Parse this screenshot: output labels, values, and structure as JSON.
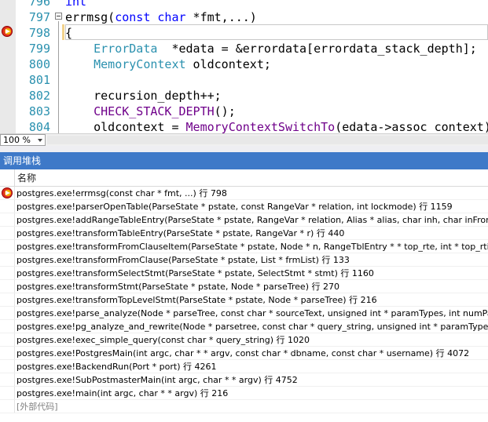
{
  "editor": {
    "lines": [
      {
        "num": "796",
        "parts": [
          {
            "t": "int",
            "c": "kw"
          }
        ]
      },
      {
        "num": "797",
        "parts": [
          {
            "t": "errmsg(",
            "c": ""
          },
          {
            "t": "const",
            "c": "kw"
          },
          {
            "t": " ",
            "c": ""
          },
          {
            "t": "char",
            "c": "kw"
          },
          {
            "t": " *fmt,...)",
            "c": ""
          }
        ]
      },
      {
        "num": "798",
        "parts": [
          {
            "t": "{",
            "c": ""
          }
        ]
      },
      {
        "num": "799",
        "parts": [
          {
            "t": "    ",
            "c": ""
          },
          {
            "t": "ErrorData",
            "c": "typ"
          },
          {
            "t": "  *edata = &errordata[errordata_stack_depth];",
            "c": ""
          }
        ]
      },
      {
        "num": "800",
        "parts": [
          {
            "t": "    ",
            "c": ""
          },
          {
            "t": "MemoryContext",
            "c": "typ"
          },
          {
            "t": " oldcontext;",
            "c": ""
          }
        ]
      },
      {
        "num": "801",
        "parts": []
      },
      {
        "num": "802",
        "parts": [
          {
            "t": "    recursion_depth++;",
            "c": ""
          }
        ]
      },
      {
        "num": "803",
        "parts": [
          {
            "t": "    ",
            "c": ""
          },
          {
            "t": "CHECK_STACK_DEPTH",
            "c": "mac"
          },
          {
            "t": "();",
            "c": ""
          }
        ]
      },
      {
        "num": "804",
        "parts": [
          {
            "t": "    oldcontext = ",
            "c": ""
          },
          {
            "t": "MemoryContextSwitchTo",
            "c": "mac"
          },
          {
            "t": "(edata->assoc_context);",
            "c": ""
          }
        ]
      }
    ],
    "current_line": "798"
  },
  "zoom": {
    "value": "100 %"
  },
  "call_stack": {
    "title": "调用堆栈",
    "column_name": "名称",
    "frames": [
      {
        "text": "postgres.exe!errmsg(const char * fmt, ...) 行 798",
        "current": true
      },
      {
        "text": "postgres.exe!parserOpenTable(ParseState * pstate, const RangeVar * relation, int lockmode) 行 1159"
      },
      {
        "text": "postgres.exe!addRangeTableEntry(ParseState * pstate, RangeVar * relation, Alias * alias, char inh, char inFromCl) 行"
      },
      {
        "text": "postgres.exe!transformTableEntry(ParseState * pstate, RangeVar * r) 行 440"
      },
      {
        "text": "postgres.exe!transformFromClauseItem(ParseState * pstate, Node * n, RangeTblEntry * * top_rte, int * top_rti, List *"
      },
      {
        "text": "postgres.exe!transformFromClause(ParseState * pstate, List * frmList) 行 133"
      },
      {
        "text": "postgres.exe!transformSelectStmt(ParseState * pstate, SelectStmt * stmt) 行 1160"
      },
      {
        "text": "postgres.exe!transformStmt(ParseState * pstate, Node * parseTree) 行 270"
      },
      {
        "text": "postgres.exe!transformTopLevelStmt(ParseState * pstate, Node * parseTree) 行 216"
      },
      {
        "text": "postgres.exe!parse_analyze(Node * parseTree, const char * sourceText, unsigned int * paramTypes, int numParams)"
      },
      {
        "text": "postgres.exe!pg_analyze_and_rewrite(Node * parsetree, const char * query_string, unsigned int * paramTypes, int nu"
      },
      {
        "text": "postgres.exe!exec_simple_query(const char * query_string) 行 1020"
      },
      {
        "text": "postgres.exe!PostgresMain(int argc, char * * argv, const char * dbname, const char * username) 行 4072"
      },
      {
        "text": "postgres.exe!BackendRun(Port * port) 行 4261"
      },
      {
        "text": "postgres.exe!SubPostmasterMain(int argc, char * * argv) 行 4752"
      },
      {
        "text": "postgres.exe!main(int argc, char * * argv) 行 216"
      },
      {
        "text": "[外部代码]",
        "external": true
      }
    ]
  },
  "icons": {
    "current_statement": "current-statement-arrow-icon",
    "fold": "collapse-icon"
  },
  "colors": {
    "panel_title_bg": "#3e79c8",
    "line_number": "#2b91af",
    "keyword": "#0000ff",
    "type": "#2b91af",
    "macro": "#6f008a"
  }
}
